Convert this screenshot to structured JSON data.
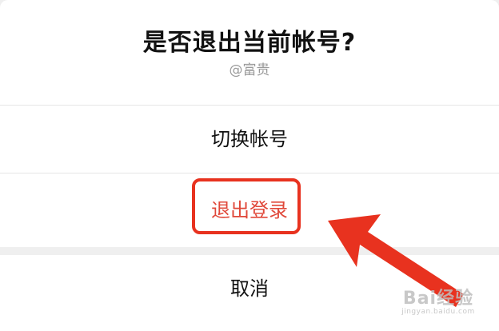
{
  "dialog": {
    "title": "是否退出当前帐号?",
    "account": "@富贵",
    "switch_account_label": "切换帐号",
    "logout_label": "退出登录",
    "cancel_label": "取消"
  },
  "annotation": {
    "highlight_color": "#e8321f",
    "arrow_color": "#e8321f"
  },
  "watermark": {
    "brand": "Bai经验",
    "url": "jingyan.baidu.com"
  }
}
